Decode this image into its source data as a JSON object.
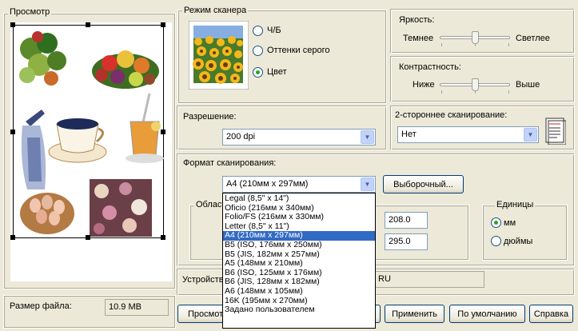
{
  "preview": {
    "title": "Просмотр"
  },
  "file_size": {
    "label": "Размер файла:",
    "value": "10.9 MB"
  },
  "mode": {
    "title": "Режим сканера",
    "options": [
      "Ч/Б",
      "Оттенки серого",
      "Цвет"
    ],
    "selected": "Цвет"
  },
  "brightness": {
    "title": "Яркость:",
    "min_label": "Темнее",
    "max_label": "Светлее",
    "value": 0.5
  },
  "contrast": {
    "title": "Контрастность:",
    "min_label": "Ниже",
    "max_label": "Выше",
    "value": 0.5
  },
  "resolution": {
    "title": "Разрешение:",
    "value": "200 dpi"
  },
  "duplex": {
    "title": "2-стороннее сканирование:",
    "value": "Нет"
  },
  "format": {
    "title": "Формат сканирования:",
    "value": "A4 (210мм x 297мм)",
    "custom_button": "Выборочный...",
    "options": [
      "Legal (8,5\" x 14\")",
      "Oficio (216мм x 340мм)",
      "Folio/FS (216мм x 330мм)",
      "Letter (8,5\" x 11\")",
      "A4 (210мм x 297мм)",
      "B5 (ISO, 176мм x 250мм)",
      "B5 (JIS, 182мм x 257мм)",
      "A5 (148мм x 210мм)",
      "B6 (ISO, 125мм x 176мм)",
      "B6 (JIS, 128мм x 182мм)",
      "A6 (148мм x 105мм)",
      "16K (195мм x 270мм)",
      "Задано пользователем"
    ],
    "selected_index": 4
  },
  "area": {
    "title_fragment": "Област",
    "width": "208.0",
    "height": "295.0"
  },
  "units": {
    "title": "Единицы",
    "options": [
      "мм",
      "дюймы"
    ],
    "selected": "мм"
  },
  "device": {
    "label_fragment": "Устройств",
    "value_fragment": "RU"
  },
  "buttons": {
    "preview": "Просмот",
    "apply": "Применить",
    "default": "По умолчанию",
    "help": "Справка"
  }
}
